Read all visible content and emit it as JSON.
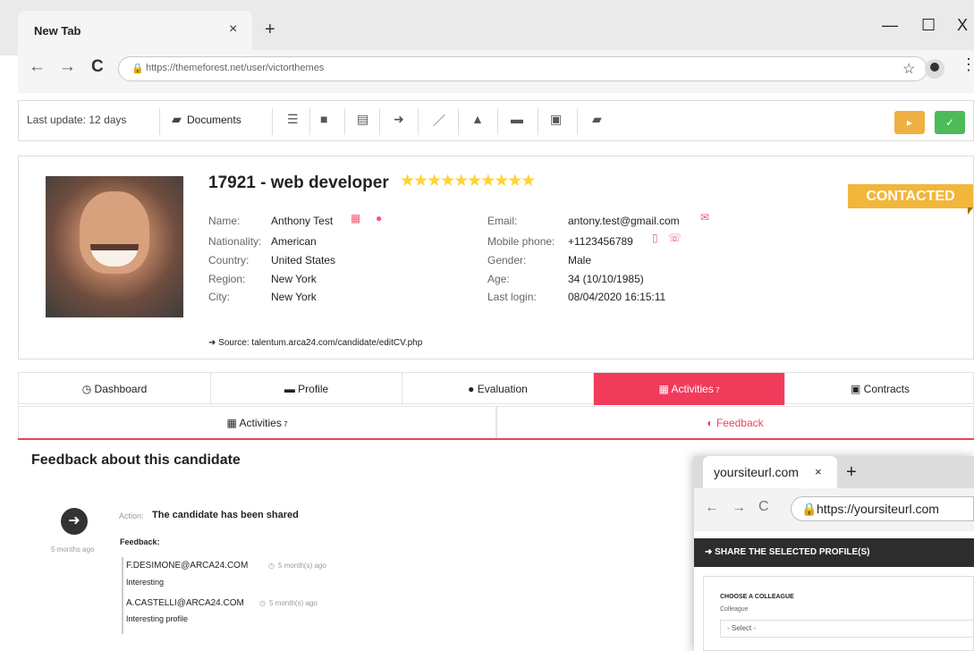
{
  "browser": {
    "tab_title": "New Tab",
    "tab_close": "×",
    "new_tab": "+",
    "window_minimize": "—",
    "window_maximize": "☐",
    "window_close": "X",
    "back": "←",
    "forward": "→",
    "reload": "C",
    "url": "https://themeforest.net/user/victorthemes",
    "bookmark": "☆",
    "menu": "⋮"
  },
  "toolbar": {
    "last_update": "Last update: 12 days",
    "documents": "Documents",
    "icons": [
      "list-icon",
      "video-icon",
      "document-icon",
      "share-icon",
      "edit-icon",
      "upload-icon",
      "archive-icon",
      "briefcase-icon",
      "print-icon"
    ],
    "play_label": "▸",
    "check_label": "✓",
    "colors": {
      "play": "#f0b044",
      "check": "#4dbb58"
    }
  },
  "candidate": {
    "title": "17921 - web developer",
    "stars": "★★★★★★★★★★",
    "status": "CONTACTED",
    "labels": {
      "name": "Name:",
      "nationality": "Nationality:",
      "country": "Country:",
      "region": "Region:",
      "city": "City:",
      "email": "Email:",
      "mobile": "Mobile phone:",
      "gender": "Gender:",
      "age": "Age:",
      "last_login": "Last login:"
    },
    "values": {
      "name": "Anthony Test",
      "nationality": "American",
      "country": "United States",
      "region": "New York",
      "city": "New York",
      "email": "antony.test@gmail.com",
      "mobile": "+1123456789",
      "gender": "Male",
      "age": "34 (10/10/1985)",
      "last_login": "08/04/2020 16:15:11"
    },
    "source": "Source: talentum.arca24.com/candidate/editCV.php"
  },
  "tabs": {
    "main": [
      "Dashboard",
      "Profile",
      "Evaluation",
      "Activities",
      "Contracts"
    ],
    "main_icons": [
      "◷",
      "▬",
      "●",
      "▦",
      "▣"
    ],
    "sub": [
      "Activities",
      "Feedback"
    ],
    "sub_icons": [
      "▦",
      "◐"
    ]
  },
  "feedback": {
    "title": "Feedback about this candidate",
    "action_label": "Action:",
    "action_text": "The candidate has been shared",
    "left_time": "5 months ago",
    "feedback_label": "Feedback:",
    "entries": [
      {
        "email": "F.DESIMONE@ARCA24.COM",
        "time": "5 month(s) ago",
        "comment": "Interesting"
      },
      {
        "email": "A.CASTELLI@ARCA24.COM",
        "time": "5 month(s) ago",
        "comment": "Interesting profile"
      }
    ]
  },
  "mini_browser": {
    "tab_title": "yoursiteurl.com",
    "tab_close": "×",
    "new_tab": "+",
    "url": "https://yoursiteurl.com",
    "share_title": "SHARE THE SELECTED PROFILE(S)",
    "choose_label": "CHOOSE A COLLEAGUE",
    "colleague_label": "Colleague",
    "select_placeholder": "- Select -"
  }
}
